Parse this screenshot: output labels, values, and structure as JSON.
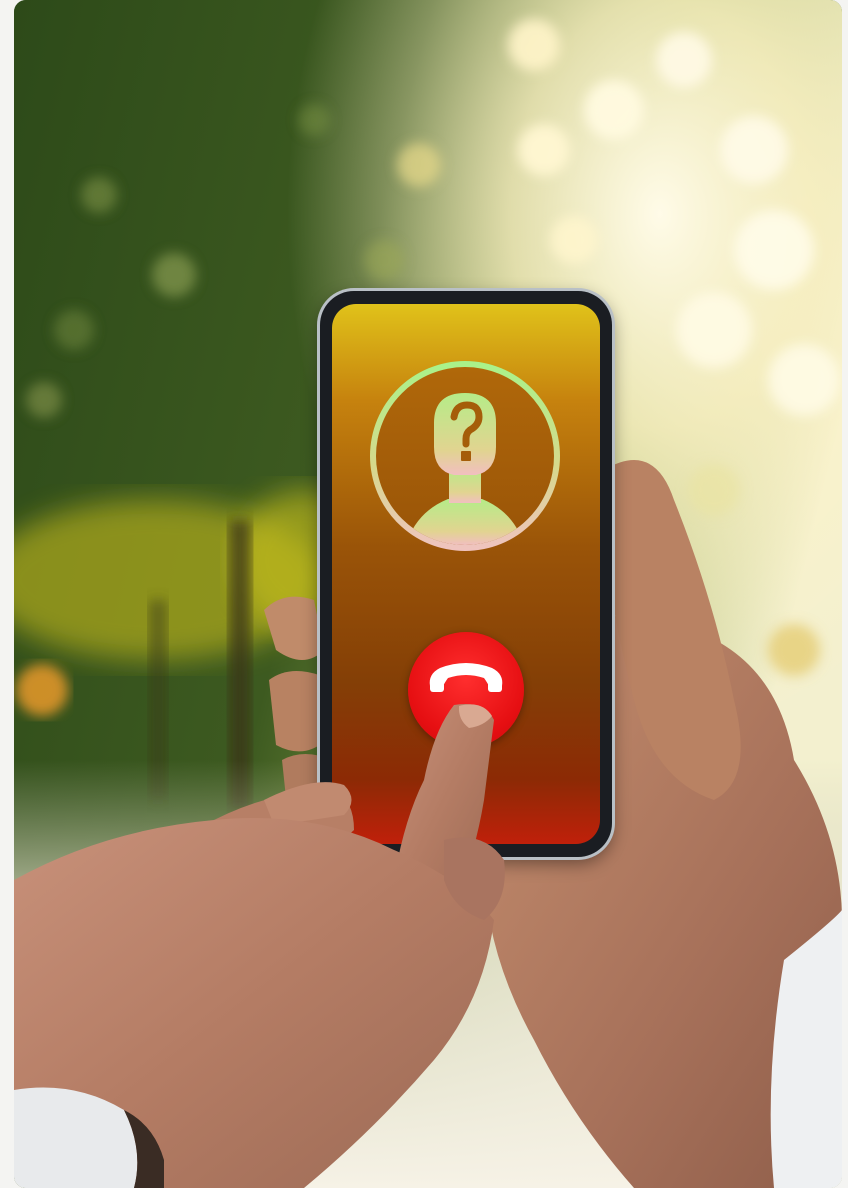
{
  "scene": {
    "description_kind": "photo",
    "screen_state": "incoming-call",
    "caller_icon": "unknown-caller-icon",
    "action_icon": "decline-call-icon"
  },
  "colors": {
    "screen_top": "#e0c21a",
    "screen_bottom": "#c0200a",
    "ring_top": "#a8f38a",
    "ring_bottom": "#f0c3c0",
    "hangup_red": "#e60f12"
  }
}
